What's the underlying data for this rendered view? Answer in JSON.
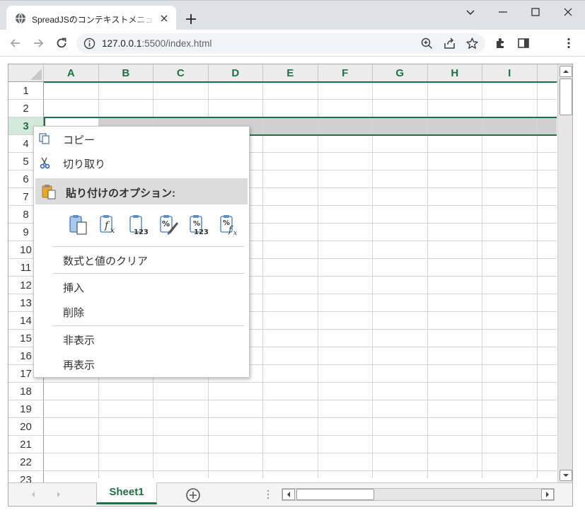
{
  "browser": {
    "tab_title": "SpreadJSのコンテキストメニューのカスタマイズ",
    "url_host": "127.0.0.1",
    "url_rest": ":5500/index.html"
  },
  "sheet": {
    "columns": [
      "A",
      "B",
      "C",
      "D",
      "E",
      "F",
      "G",
      "H",
      "I"
    ],
    "rows": [
      "1",
      "2",
      "3",
      "4",
      "5",
      "6",
      "7",
      "8",
      "9",
      "10",
      "11",
      "12",
      "13",
      "14",
      "15",
      "16",
      "17",
      "18",
      "19",
      "20",
      "21",
      "22",
      "23"
    ],
    "selected_row": "3",
    "tab_name": "Sheet1"
  },
  "context_menu": {
    "copy": "コピー",
    "cut": "切り取り",
    "paste_options": "貼り付けのオプション:",
    "clear": "数式と値のクリア",
    "insert": "挿入",
    "delete": "削除",
    "hide": "非表示",
    "unhide": "再表示",
    "paste_icons": [
      "paste-all-icon",
      "paste-formulas-icon",
      "paste-values-icon",
      "paste-formatting-icon",
      "paste-values-formatting-icon",
      "paste-formulas-formatting-icon"
    ]
  },
  "colors": {
    "accent": "#1e7145",
    "selection": "#d0d0d0"
  }
}
